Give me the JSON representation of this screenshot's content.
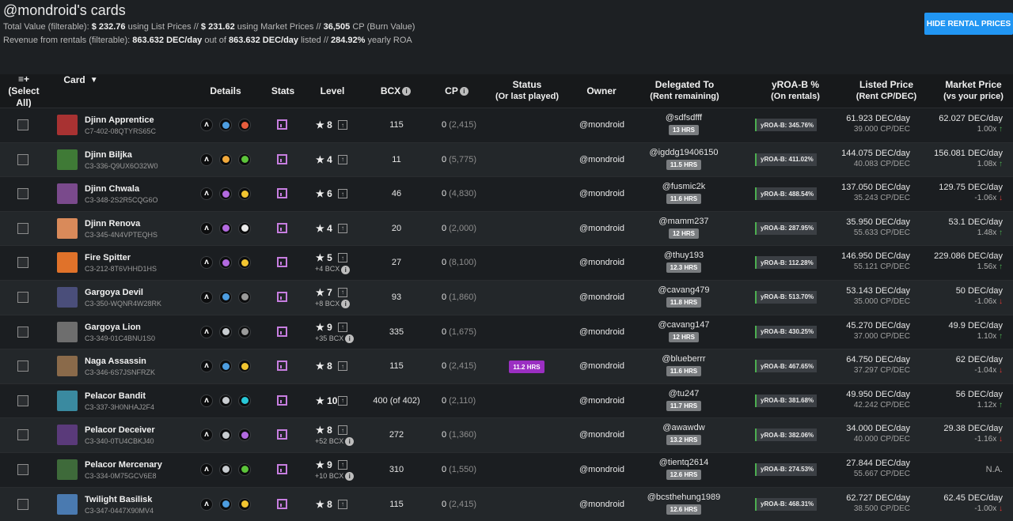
{
  "header": {
    "title": "@mondroid's cards",
    "total_prefix": "Total Value (filterable):",
    "total_list": "$ 232.76",
    "total_list_suffix": "using List Prices //",
    "total_market": "$ 231.62",
    "total_market_suffix": "using Market Prices //",
    "burn_cp": "36,505",
    "burn_suffix": "CP (Burn Value)",
    "revenue_prefix": "Revenue from rentals (filterable):",
    "revenue_value": "863.632 DEC/day",
    "revenue_mid": "out of",
    "revenue_listed": "863.632 DEC/day",
    "revenue_listed_suffix": "listed //",
    "roa": "284.92%",
    "roa_suffix": "yearly ROA",
    "hide_button": "HIDE RENTAL PRICES"
  },
  "columns": {
    "select": "≡+",
    "select_all": "(Select All)",
    "card": "Card",
    "details": "Details",
    "stats": "Stats",
    "level": "Level",
    "bcx": "BCX",
    "cp": "CP",
    "status": "Status",
    "status_sub": "(Or last played)",
    "owner": "Owner",
    "delegated": "Delegated To",
    "delegated_sub": "(Rent remaining)",
    "yroa": "yROA-B %",
    "yroa_sub": "(On rentals)",
    "listed": "Listed Price",
    "listed_sub": "(Rent CP/DEC)",
    "market": "Market Price",
    "market_sub": "(vs your price)"
  },
  "rows": [
    {
      "name": "Djinn Apprentice",
      "uid": "C7-402-08QTYRS65C",
      "dots": [
        "#0c0d0e",
        "#4d9de0",
        "#e85d3d"
      ],
      "level": "8",
      "lvl_bcx": "",
      "bcx": "115",
      "cp": "0",
      "cp_muted": "(2,415)",
      "status": "",
      "owner": "@mondroid",
      "deleg": "@sdfsdfff",
      "hrs": "13 HRS",
      "yroa": "yROA-B: 345.76%",
      "listed": "61.923 DEC/day",
      "listed_cp": "39.000 CP/DEC",
      "market": "62.027 DEC/day",
      "ratio": "1.00x",
      "dir": "up",
      "thumb": "#a83232"
    },
    {
      "name": "Djinn Biljka",
      "uid": "C3-336-Q9UX6O32W0",
      "dots": [
        "#0c0d0e",
        "#f2a93b",
        "#5cc43a"
      ],
      "level": "4",
      "lvl_bcx": "",
      "bcx": "11",
      "cp": "0",
      "cp_muted": "(5,775)",
      "status": "",
      "owner": "@mondroid",
      "deleg": "@igddg19406150",
      "hrs": "11.5 HRS",
      "yroa": "yROA-B: 411.02%",
      "listed": "144.075 DEC/day",
      "listed_cp": "40.083 CP/DEC",
      "market": "156.081 DEC/day",
      "ratio": "1.08x",
      "dir": "up",
      "thumb": "#3f7a36"
    },
    {
      "name": "Djinn Chwala",
      "uid": "C3-348-2S2R5CQG6O",
      "dots": [
        "#0c0d0e",
        "#b36ae0",
        "#f2c530"
      ],
      "level": "6",
      "lvl_bcx": "",
      "bcx": "46",
      "cp": "0",
      "cp_muted": "(4,830)",
      "status": "",
      "owner": "@mondroid",
      "deleg": "@fusmic2k",
      "hrs": "11.6 HRS",
      "yroa": "yROA-B: 488.54%",
      "listed": "137.050 DEC/day",
      "listed_cp": "35.243 CP/DEC",
      "market": "129.75 DEC/day",
      "ratio": "-1.06x",
      "dir": "down",
      "thumb": "#7a4a8c"
    },
    {
      "name": "Djinn Renova",
      "uid": "C3-345-4N4VPTEQHS",
      "dots": [
        "#0c0d0e",
        "#b36ae0",
        "#eaeaea"
      ],
      "level": "4",
      "lvl_bcx": "",
      "bcx": "20",
      "cp": "0",
      "cp_muted": "(2,000)",
      "status": "",
      "owner": "@mondroid",
      "deleg": "@mamm237",
      "hrs": "12 HRS",
      "yroa": "yROA-B: 287.95%",
      "listed": "35.950 DEC/day",
      "listed_cp": "55.633 CP/DEC",
      "market": "53.1 DEC/day",
      "ratio": "1.48x",
      "dir": "up",
      "thumb": "#d98a5a"
    },
    {
      "name": "Fire Spitter",
      "uid": "C3-212-8T6VHHD1HS",
      "dots": [
        "#0c0d0e",
        "#b36ae0",
        "#f2c530"
      ],
      "level": "5",
      "lvl_bcx": "+4 BCX",
      "bcx": "27",
      "cp": "0",
      "cp_muted": "(8,100)",
      "status": "",
      "owner": "@mondroid",
      "deleg": "@thuy193",
      "hrs": "12.3 HRS",
      "yroa": "yROA-B: 112.28%",
      "listed": "146.950 DEC/day",
      "listed_cp": "55.121 CP/DEC",
      "market": "229.086 DEC/day",
      "ratio": "1.56x",
      "dir": "up",
      "thumb": "#e0722a"
    },
    {
      "name": "Gargoya Devil",
      "uid": "C3-350-WQNR4W28RK",
      "dots": [
        "#0c0d0e",
        "#4d9de0",
        "#9a9a9a"
      ],
      "level": "7",
      "lvl_bcx": "+8 BCX",
      "bcx": "93",
      "cp": "0",
      "cp_muted": "(1,860)",
      "status": "",
      "owner": "@mondroid",
      "deleg": "@cavang479",
      "hrs": "11.8 HRS",
      "yroa": "yROA-B: 513.70%",
      "listed": "53.143 DEC/day",
      "listed_cp": "35.000 CP/DEC",
      "market": "50 DEC/day",
      "ratio": "-1.06x",
      "dir": "down",
      "thumb": "#4a4e7a"
    },
    {
      "name": "Gargoya Lion",
      "uid": "C3-349-01C4BNU1S0",
      "dots": [
        "#0c0d0e",
        "#c8ccd0",
        "#9a9a9a"
      ],
      "level": "9",
      "lvl_bcx": "+35 BCX",
      "bcx": "335",
      "cp": "0",
      "cp_muted": "(1,675)",
      "status": "",
      "owner": "@mondroid",
      "deleg": "@cavang147",
      "hrs": "12 HRS",
      "yroa": "yROA-B: 430.25%",
      "listed": "45.270 DEC/day",
      "listed_cp": "37.000 CP/DEC",
      "market": "49.9 DEC/day",
      "ratio": "1.10x",
      "dir": "up",
      "thumb": "#6e6e6e"
    },
    {
      "name": "Naga Assassin",
      "uid": "C3-346-6S7JSNFRZK",
      "dots": [
        "#0c0d0e",
        "#4d9de0",
        "#f2c530"
      ],
      "level": "8",
      "lvl_bcx": "",
      "bcx": "115",
      "cp": "0",
      "cp_muted": "(2,415)",
      "status": "11.2 HRS",
      "owner": "@mondroid",
      "deleg": "@blueberrr",
      "hrs": "11.6 HRS",
      "yroa": "yROA-B: 467.65%",
      "listed": "64.750 DEC/day",
      "listed_cp": "37.297 CP/DEC",
      "market": "62 DEC/day",
      "ratio": "-1.04x",
      "dir": "down",
      "thumb": "#8a6a4a"
    },
    {
      "name": "Pelacor Bandit",
      "uid": "C3-337-3H0NHAJ2F4",
      "dots": [
        "#0c0d0e",
        "#c8ccd0",
        "#28c7d8"
      ],
      "level": "10",
      "lvl_bcx": "",
      "bcx": "400 (of 402)",
      "cp": "0",
      "cp_muted": "(2,110)",
      "status": "",
      "owner": "@mondroid",
      "deleg": "@tu247",
      "hrs": "11.7 HRS",
      "yroa": "yROA-B: 381.68%",
      "listed": "49.950 DEC/day",
      "listed_cp": "42.242 CP/DEC",
      "market": "56 DEC/day",
      "ratio": "1.12x",
      "dir": "up",
      "thumb": "#3a8aa0"
    },
    {
      "name": "Pelacor Deceiver",
      "uid": "C3-340-0TU4CBKJ40",
      "dots": [
        "#0c0d0e",
        "#c8ccd0",
        "#b36ae0"
      ],
      "level": "8",
      "lvl_bcx": "+52 BCX",
      "bcx": "272",
      "cp": "0",
      "cp_muted": "(1,360)",
      "status": "",
      "owner": "@mondroid",
      "deleg": "@awawdw",
      "hrs": "13.2 HRS",
      "yroa": "yROA-B: 382.06%",
      "listed": "34.000 DEC/day",
      "listed_cp": "40.000 CP/DEC",
      "market": "29.38 DEC/day",
      "ratio": "-1.16x",
      "dir": "down",
      "thumb": "#5a3a7a"
    },
    {
      "name": "Pelacor Mercenary",
      "uid": "C3-334-0M75GCV6E8",
      "dots": [
        "#0c0d0e",
        "#c8ccd0",
        "#5cc43a"
      ],
      "level": "9",
      "lvl_bcx": "+10 BCX",
      "bcx": "310",
      "cp": "0",
      "cp_muted": "(1,550)",
      "status": "",
      "owner": "@mondroid",
      "deleg": "@tientq2614",
      "hrs": "12.6 HRS",
      "yroa": "yROA-B: 274.53%",
      "listed": "27.844 DEC/day",
      "listed_cp": "55.667 CP/DEC",
      "market": "N.A.",
      "ratio": "",
      "dir": "na",
      "thumb": "#3e6a3a"
    },
    {
      "name": "Twilight Basilisk",
      "uid": "C3-347-0447X90MV4",
      "dots": [
        "#0c0d0e",
        "#4d9de0",
        "#f2c530"
      ],
      "level": "8",
      "lvl_bcx": "",
      "bcx": "115",
      "cp": "0",
      "cp_muted": "(2,415)",
      "status": "",
      "owner": "@mondroid",
      "deleg": "@bcsthehung1989",
      "hrs": "12.6 HRS",
      "yroa": "yROA-B: 468.31%",
      "listed": "62.727 DEC/day",
      "listed_cp": "38.500 CP/DEC",
      "market": "62.45 DEC/day",
      "ratio": "-1.00x",
      "dir": "down",
      "thumb": "#4a7ab0"
    }
  ]
}
